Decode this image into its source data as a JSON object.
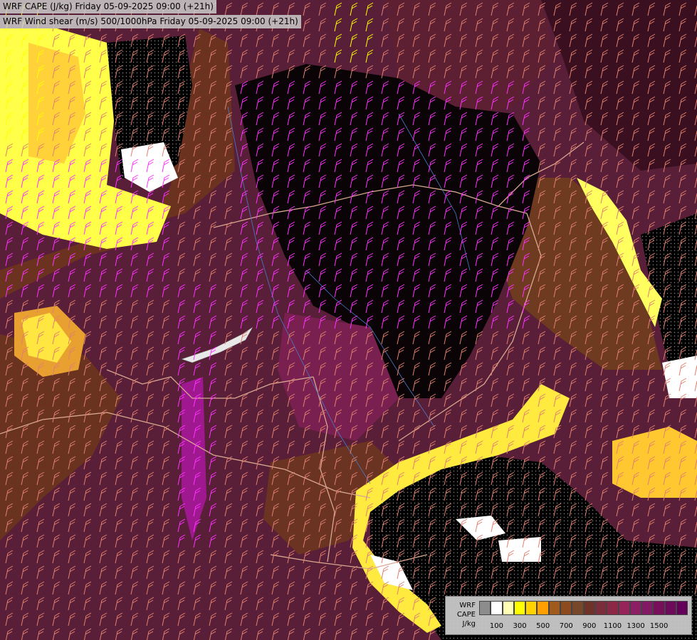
{
  "titles": {
    "line1": "WRF CAPE (J/kg) Friday 05-09-2025 09:00 (+21h)",
    "line2": "WRF Wind shear (m/s) 500/1000hPa Friday 05-09-2025 09:00 (+21h)"
  },
  "legend": {
    "label_lines": [
      "WRF",
      "CAPE",
      "J/kg"
    ],
    "colors": [
      "#8c8c8c",
      "#ffffff",
      "#ffffb4",
      "#ffff00",
      "#ffd200",
      "#ffa000",
      "#a05a1e",
      "#8c4b1e",
      "#784628",
      "#6e3228",
      "#7c2d3c",
      "#8c2846",
      "#96235a",
      "#8c1e64",
      "#821964",
      "#780f5a",
      "#6e0a5a",
      "#64005a"
    ],
    "tick_labels": [
      "100",
      "300",
      "500",
      "700",
      "900",
      "1100",
      "1300",
      "1500"
    ]
  },
  "colors": {
    "high_cape": "#5a1a3e",
    "mid_cape": "#7a3a20",
    "low_cape": "#ffff44",
    "zero_cape": "#000000",
    "barb_strong": "#ff33ff",
    "barb_weak": "#e08070"
  }
}
